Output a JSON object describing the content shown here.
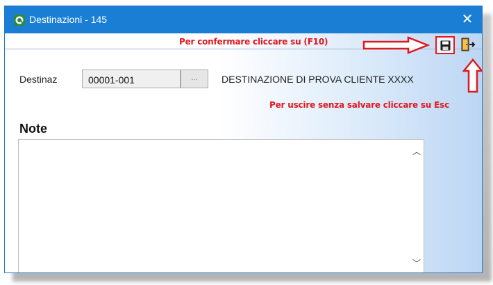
{
  "window": {
    "title": "Destinazioni - 145",
    "close_symbol": "✕"
  },
  "hints": {
    "confirm": "Per confermare cliccare su (F10)",
    "exit": "Per uscire senza salvare cliccare su Esc"
  },
  "toolbar": {
    "save_icon": "floppy-disk-save-icon",
    "exit_icon": "door-exit-icon"
  },
  "destination": {
    "label": "Destinaz",
    "code": "00001-001",
    "lookup_label": "...",
    "description": "DESTINAZIONE DI PROVA CLIENTE XXXX"
  },
  "notes": {
    "label": "Note",
    "value": ""
  },
  "colors": {
    "titlebar": "#1a7fd4",
    "hint_red": "#e0191f",
    "client_gradient_end": "#bcd6f4"
  }
}
